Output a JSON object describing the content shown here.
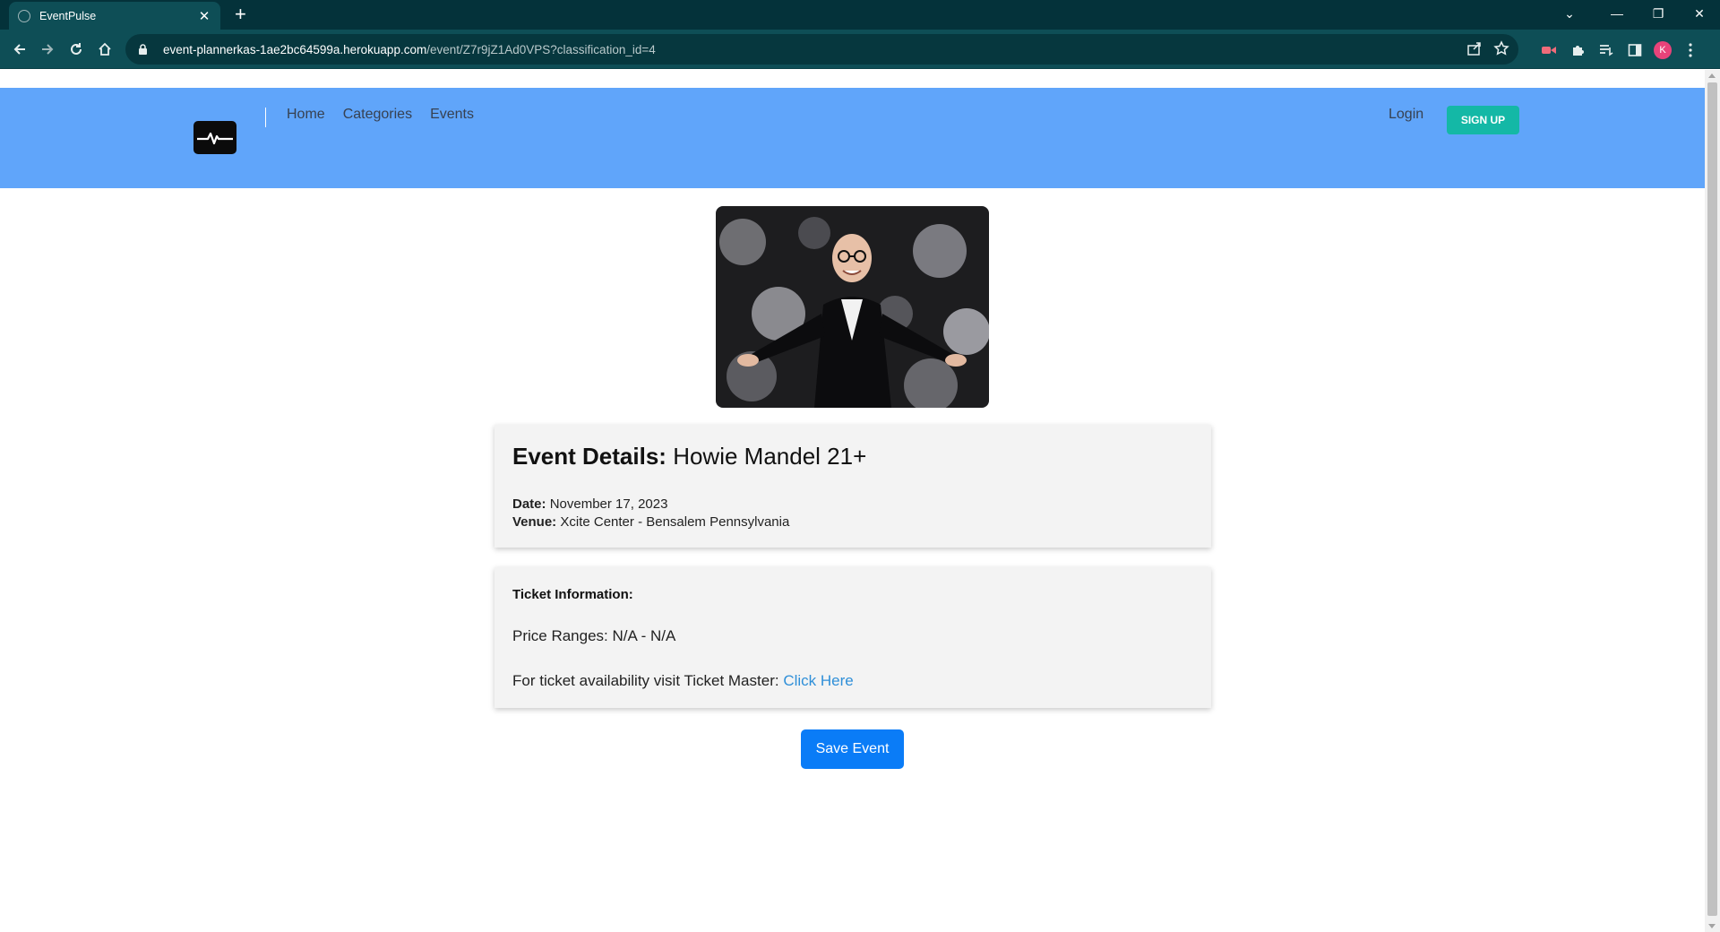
{
  "browser": {
    "tab_title": "EventPulse",
    "tab_close": "✕",
    "new_tab": "+",
    "url_host": "event-plannerkas-1ae2bc64599a.herokuapp.com",
    "url_path": "/event/Z7r9jZ1Ad0VPS?classification_id=4",
    "profile_initial": "K",
    "win_list_tabs": "⌄",
    "win_minimize": "—",
    "win_restore": "❐",
    "win_close": "✕"
  },
  "header": {
    "nav": [
      "Home",
      "Categories",
      "Events"
    ],
    "login": "Login",
    "signup": "SIGN UP"
  },
  "event": {
    "details_label": "Event Details:",
    "name": "Howie Mandel 21+",
    "date_label": "Date:",
    "date": "November 17, 2023",
    "venue_label": "Venue:",
    "venue": "Xcite Center - Bensalem Pennsylvania"
  },
  "tickets": {
    "heading": "Ticket Information:",
    "price_label": "Price Ranges:",
    "price": "N/A - N/A",
    "availability_text": "For ticket availability visit Ticket Master:",
    "link_text": "Click Here"
  },
  "actions": {
    "save_event": "Save Event"
  },
  "colors": {
    "chrome_bg": "#04323a",
    "toolbar_bg": "#0e4e56",
    "header_bg": "#60a5fa",
    "signup_bg": "#14b8a6",
    "save_bg": "#0a7cf7",
    "link": "#2f8fd8"
  }
}
